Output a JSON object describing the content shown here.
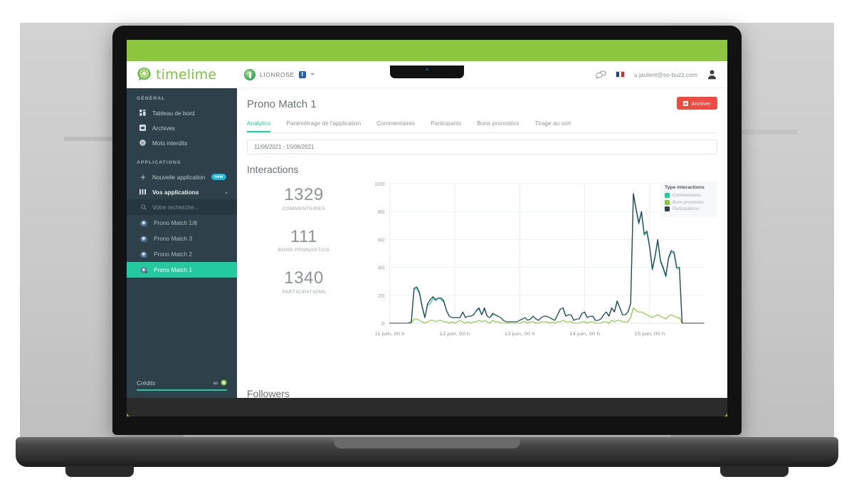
{
  "topbar": {
    "logo_text": "timelime",
    "logo_icon": "lime-speech-bubble-icon",
    "brand_name": "LIONROSE",
    "brand_icon": "lime-avatar-icon",
    "facebook_icon": "facebook-icon",
    "facebook_letter": "f",
    "dropdown_icon": "chevron-down-icon",
    "chat_icon": "chat-bubbles-icon",
    "flag_icon": "french-flag-icon",
    "flag_colors": [
      "#21438a",
      "#ffffff",
      "#e0252c"
    ],
    "user_email": "u.jaulent@so-buzz.com",
    "avatar_icon": "user-avatar-icon"
  },
  "sidebar": {
    "section_general": "GÉNÉRAL",
    "general_items": [
      {
        "label": "Tableau de bord",
        "icon": "dashboard-grid-icon"
      },
      {
        "label": "Archives",
        "icon": "archive-box-icon"
      },
      {
        "label": "Mots interdits",
        "icon": "forbidden-face-icon"
      }
    ],
    "section_applications": "APPLICATIONS",
    "new_app": {
      "label": "Nouvelle application",
      "icon": "plus-icon",
      "badge": "new"
    },
    "your_apps": {
      "label": "Vos applications",
      "icon": "columns-icon",
      "caret": "chevron-down-icon"
    },
    "search_placeholder": "Votre recherche...",
    "search_icon": "search-icon",
    "apps": [
      {
        "label": "Prono Match 1/8",
        "icon": "gear-app-icon",
        "active": false
      },
      {
        "label": "Prono Match 3",
        "icon": "gear-app-icon",
        "active": false
      },
      {
        "label": "Prono Match 2",
        "icon": "gear-app-icon",
        "active": false
      },
      {
        "label": "Prono Match 1",
        "icon": "gear-app-icon",
        "active": true
      }
    ],
    "credits_label": "Crédits",
    "credits_value": "∞",
    "credits_icon": "lime-coin-icon",
    "credits_progress_pct": 100
  },
  "main": {
    "page_title": "Prono Match 1",
    "archive_button": {
      "label": "Archiver",
      "icon": "archive-box-icon",
      "color": "#ee4b42"
    },
    "tabs": [
      {
        "label": "Analytics",
        "active": true
      },
      {
        "label": "Paramétrage de l'application",
        "active": false
      },
      {
        "label": "Commentaires",
        "active": false
      },
      {
        "label": "Participants",
        "active": false
      },
      {
        "label": "Bons pronostics",
        "active": false
      },
      {
        "label": "Tirage au sort",
        "active": false
      }
    ],
    "date_range": "11/06/2021 - 15/06/2021",
    "section_heading": "Interactions",
    "next_section_heading": "Followers",
    "stats": [
      {
        "number": "1329",
        "label": "COMMENTAIRES"
      },
      {
        "number": "111",
        "label": "BONS PRONOSTICS"
      },
      {
        "number": "1340",
        "label": "PARTICIPATIONS"
      }
    ],
    "legend_title": "Type interactions"
  },
  "chart_data": {
    "type": "line",
    "title": "Interactions",
    "xlabel": "",
    "ylabel": "",
    "ylim": [
      0,
      100
    ],
    "yticks": [
      0,
      20,
      40,
      60,
      80,
      100
    ],
    "grid": true,
    "legend_position": "right",
    "x_tick_labels": [
      "11 juin, 00 h",
      "12 juin, 00 h",
      "13 juin, 00 h",
      "14 juin, 00 h",
      "15 juin, 00 h"
    ],
    "x_tick_positions": [
      0,
      24,
      48,
      72,
      96
    ],
    "x_range": [
      0,
      116
    ],
    "series": [
      {
        "name": "Participations",
        "color": "#2c4450",
        "values": [
          0,
          0,
          0,
          0,
          0,
          0,
          0,
          0,
          1,
          25,
          26,
          22,
          12,
          4,
          14,
          17,
          19,
          17,
          18,
          18,
          16,
          9,
          5,
          4,
          4,
          4,
          4,
          8,
          4,
          5,
          5,
          6,
          9,
          11,
          6,
          11,
          5,
          4,
          7,
          6,
          5,
          4,
          2,
          1,
          1,
          1,
          1,
          1,
          2,
          3,
          4,
          2,
          3,
          5,
          3,
          2,
          4,
          5,
          5,
          4,
          3,
          2,
          6,
          10,
          11,
          5,
          6,
          6,
          2,
          3,
          3,
          7,
          8,
          4,
          5,
          5,
          2,
          2,
          3,
          6,
          8,
          5,
          11,
          8,
          16,
          11,
          6,
          6,
          8,
          14,
          93,
          82,
          72,
          80,
          64,
          66,
          55,
          39,
          48,
          60,
          45,
          40,
          34,
          47,
          52,
          51,
          40,
          40,
          0,
          0,
          0,
          0,
          0,
          0,
          0,
          0,
          0
        ]
      },
      {
        "name": "Commentaires",
        "color": "#24c9a0",
        "values": [
          0,
          0,
          0,
          0,
          0,
          0,
          0,
          0,
          1,
          24,
          25,
          21,
          11,
          4,
          13,
          14,
          18,
          16,
          18,
          17,
          15,
          9,
          5,
          4,
          4,
          4,
          4,
          8,
          4,
          5,
          5,
          6,
          9,
          10,
          6,
          10,
          5,
          4,
          6,
          6,
          5,
          4,
          2,
          1,
          1,
          1,
          1,
          1,
          2,
          3,
          4,
          2,
          3,
          5,
          3,
          2,
          4,
          5,
          5,
          4,
          3,
          2,
          6,
          10,
          11,
          5,
          6,
          6,
          2,
          3,
          3,
          7,
          8,
          4,
          5,
          5,
          2,
          2,
          3,
          6,
          8,
          5,
          11,
          8,
          15,
          11,
          6,
          6,
          8,
          14,
          92,
          81,
          71,
          79,
          63,
          65,
          54,
          38,
          47,
          59,
          44,
          39,
          33,
          46,
          51,
          50,
          39,
          39,
          0,
          0,
          0,
          0,
          0,
          0,
          0,
          0,
          0
        ]
      },
      {
        "name": "Bons pronostics",
        "color": "#8cc63e",
        "values": [
          0,
          0,
          0,
          0,
          0,
          0,
          0,
          0,
          0,
          3,
          3,
          2,
          1,
          0,
          1,
          2,
          2,
          1,
          2,
          2,
          1,
          1,
          0,
          1,
          0,
          1,
          2,
          1,
          0,
          1,
          0,
          1,
          1,
          2,
          1,
          2,
          1,
          0,
          2,
          1,
          1,
          0,
          0,
          0,
          0,
          0,
          0,
          0,
          0,
          1,
          1,
          0,
          1,
          1,
          0,
          0,
          1,
          1,
          1,
          0,
          1,
          0,
          1,
          1,
          2,
          1,
          1,
          1,
          0,
          0,
          0,
          1,
          1,
          0,
          1,
          1,
          0,
          0,
          0,
          1,
          1,
          0,
          2,
          1,
          2,
          2,
          1,
          1,
          1,
          4,
          11,
          9,
          8,
          8,
          7,
          6,
          5,
          4,
          5,
          6,
          5,
          4,
          3,
          5,
          6,
          5,
          4,
          4,
          0,
          0,
          0,
          0,
          0,
          0,
          0,
          0,
          0
        ]
      }
    ]
  }
}
